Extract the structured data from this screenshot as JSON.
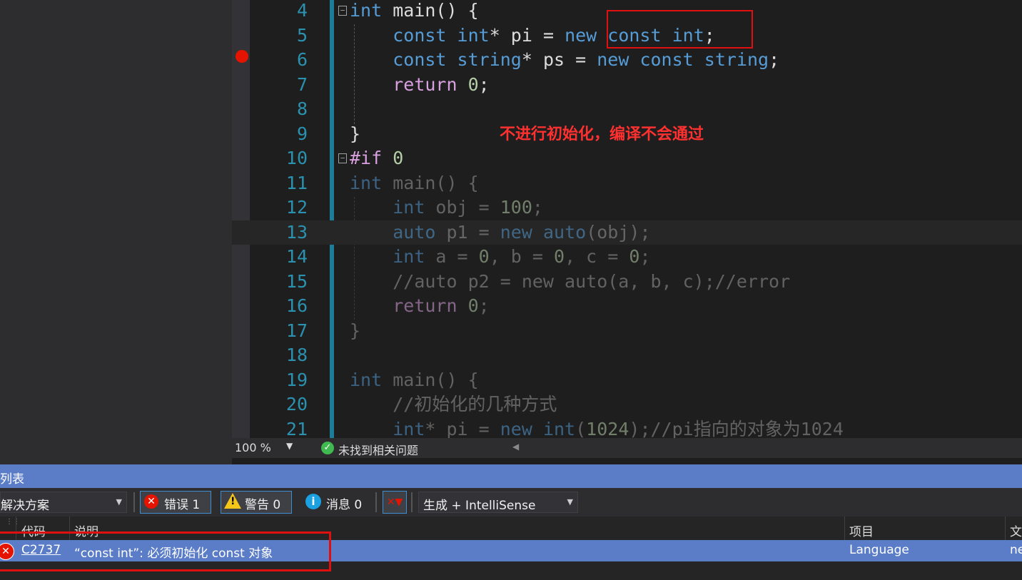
{
  "editor": {
    "lines": [
      {
        "n": "4",
        "tokens": [
          {
            "t": "int",
            "c": "kw"
          },
          {
            "t": " main() {",
            "c": ""
          }
        ]
      },
      {
        "n": "5",
        "tokens": [
          {
            "t": "    ",
            "c": ""
          },
          {
            "t": "const",
            "c": "kw"
          },
          {
            "t": " ",
            "c": ""
          },
          {
            "t": "int",
            "c": "kw"
          },
          {
            "t": "* pi = ",
            "c": ""
          },
          {
            "t": "new",
            "c": "kw"
          },
          {
            "t": " ",
            "c": ""
          },
          {
            "t": "const",
            "c": "kw"
          },
          {
            "t": " ",
            "c": ""
          },
          {
            "t": "int",
            "c": "kw"
          },
          {
            "t": ";",
            "c": ""
          }
        ]
      },
      {
        "n": "6",
        "tokens": [
          {
            "t": "    ",
            "c": ""
          },
          {
            "t": "const",
            "c": "kw"
          },
          {
            "t": " ",
            "c": ""
          },
          {
            "t": "string",
            "c": "kw"
          },
          {
            "t": "* ps = ",
            "c": ""
          },
          {
            "t": "new",
            "c": "kw"
          },
          {
            "t": " ",
            "c": ""
          },
          {
            "t": "const",
            "c": "kw"
          },
          {
            "t": " ",
            "c": ""
          },
          {
            "t": "string",
            "c": "kw"
          },
          {
            "t": ";",
            "c": ""
          }
        ]
      },
      {
        "n": "7",
        "tokens": [
          {
            "t": "    ",
            "c": ""
          },
          {
            "t": "return",
            "c": "ctl"
          },
          {
            "t": " ",
            "c": ""
          },
          {
            "t": "0",
            "c": "num"
          },
          {
            "t": ";",
            "c": ""
          }
        ]
      },
      {
        "n": "8",
        "tokens": []
      },
      {
        "n": "9",
        "tokens": [
          {
            "t": "}",
            "c": ""
          }
        ]
      },
      {
        "n": "10",
        "tokens": [
          {
            "t": "#if",
            "c": "ctl"
          },
          {
            "t": " ",
            "c": ""
          },
          {
            "t": "0",
            "c": "num"
          }
        ]
      },
      {
        "n": "11",
        "tokens": [
          {
            "t": "int",
            "c": "kw"
          },
          {
            "t": " main() {",
            "c": ""
          }
        ],
        "inactive": true
      },
      {
        "n": "12",
        "tokens": [
          {
            "t": "    ",
            "c": ""
          },
          {
            "t": "int",
            "c": "kw"
          },
          {
            "t": " obj = ",
            "c": ""
          },
          {
            "t": "100",
            "c": "num"
          },
          {
            "t": ";",
            "c": ""
          }
        ],
        "inactive": true
      },
      {
        "n": "13",
        "tokens": [
          {
            "t": "    ",
            "c": ""
          },
          {
            "t": "auto",
            "c": "kw"
          },
          {
            "t": " p1 = ",
            "c": ""
          },
          {
            "t": "new",
            "c": "kw"
          },
          {
            "t": " ",
            "c": ""
          },
          {
            "t": "auto",
            "c": "kw"
          },
          {
            "t": "(obj);",
            "c": ""
          }
        ],
        "inactive": true
      },
      {
        "n": "14",
        "tokens": [
          {
            "t": "    ",
            "c": ""
          },
          {
            "t": "int",
            "c": "kw"
          },
          {
            "t": " a = ",
            "c": ""
          },
          {
            "t": "0",
            "c": "num"
          },
          {
            "t": ", b = ",
            "c": ""
          },
          {
            "t": "0",
            "c": "num"
          },
          {
            "t": ", c = ",
            "c": ""
          },
          {
            "t": "0",
            "c": "num"
          },
          {
            "t": ";",
            "c": ""
          }
        ],
        "inactive": true
      },
      {
        "n": "15",
        "tokens": [
          {
            "t": "    ",
            "c": ""
          },
          {
            "t": "//auto p2 = new auto(a, b, c);//error",
            "c": "pp"
          }
        ],
        "inactive": true
      },
      {
        "n": "16",
        "tokens": [
          {
            "t": "    ",
            "c": ""
          },
          {
            "t": "return",
            "c": "ctl"
          },
          {
            "t": " ",
            "c": ""
          },
          {
            "t": "0",
            "c": "num"
          },
          {
            "t": ";",
            "c": ""
          }
        ],
        "inactive": true
      },
      {
        "n": "17",
        "tokens": [
          {
            "t": "}",
            "c": ""
          }
        ],
        "inactive": true
      },
      {
        "n": "18",
        "tokens": [],
        "inactive": true
      },
      {
        "n": "19",
        "tokens": [
          {
            "t": "int",
            "c": "kw"
          },
          {
            "t": " main() {",
            "c": ""
          }
        ],
        "inactive": true
      },
      {
        "n": "20",
        "tokens": [
          {
            "t": "    ",
            "c": ""
          },
          {
            "t": "//初始化的几种方式",
            "c": "pp"
          }
        ],
        "inactive": true
      },
      {
        "n": "21",
        "tokens": [
          {
            "t": "    ",
            "c": ""
          },
          {
            "t": "int",
            "c": "kw"
          },
          {
            "t": "* pi = ",
            "c": ""
          },
          {
            "t": "new",
            "c": "kw"
          },
          {
            "t": " ",
            "c": ""
          },
          {
            "t": "int",
            "c": "kw"
          },
          {
            "t": "(",
            "c": ""
          },
          {
            "t": "1024",
            "c": "num"
          },
          {
            "t": ");",
            "c": ""
          },
          {
            "t": "//pi指向的对象为1024",
            "c": "pp"
          }
        ],
        "inactive": true
      }
    ],
    "annotation": "不进行初始化，编译不会通过"
  },
  "statusbar": {
    "zoom": "100 %",
    "issues": "未找到相关问题"
  },
  "error_list": {
    "title": "列表",
    "scope": "解决方案",
    "errors_label": "错误 1",
    "warnings_label": "警告 0",
    "messages_label": "消息 0",
    "build_filter": "生成 + IntelliSense",
    "columns": {
      "code": "代码",
      "description": "说明",
      "project": "项目",
      "file": "文"
    },
    "rows": [
      {
        "code": "C2737",
        "description": "“const int”: 必须初始化 const 对象",
        "project": "Language",
        "file": "ne"
      }
    ]
  }
}
